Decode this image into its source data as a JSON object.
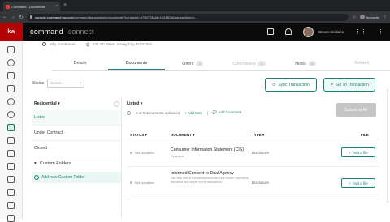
{
  "browser": {
    "tab_title": "Command | Documents",
    "url_host": "console.command.kw.com",
    "url_path": "/command/transactions/documents?contactId=8795778&id=1624806&transactionId=...",
    "incognito_label": "Incognito"
  },
  "app": {
    "logo": "kw",
    "brand": "command",
    "brand_secondary": "connect",
    "user_name": "Steven Siciliano"
  },
  "contact": {
    "name": "Billy Sunderman",
    "address": "234 4th Street Jersey City, NJ 07302"
  },
  "tabs": [
    {
      "label": "Details"
    },
    {
      "label": "Documents"
    },
    {
      "label": "Offers",
      "count": "0"
    },
    {
      "label": "Commission",
      "count": "0"
    },
    {
      "label": "Notes",
      "count": "0"
    },
    {
      "label": "Related"
    }
  ],
  "status": {
    "label": "Status",
    "placeholder": "Select..."
  },
  "buttons": {
    "sync": "Sync Transaction",
    "goto": "Go To Transaction",
    "submit": "Submit to AF"
  },
  "folders": {
    "header": "Residential",
    "items": [
      "Listed",
      "Under Contract",
      "Closed"
    ],
    "custom_header": "Custom Folders",
    "add_label": "Add new Custom Folder"
  },
  "documents": {
    "header": "Listed",
    "uploaded_text": "0 of 8 documents uploaded",
    "add_item": "Add item",
    "add_comment": "Add Comment",
    "columns": {
      "status": "STATUS",
      "document": "DOCUMENT",
      "type": "TYPE",
      "file": "FILE"
    },
    "rows": [
      {
        "status": "Not uploaded",
        "name": "Consumer Information Statement (CIS)",
        "sub": "Required",
        "type": "Disclosure",
        "action": "Add a file"
      },
      {
        "status": "Not uploaded",
        "name": "Informed Consent to Dual Agency",
        "sub": "",
        "desc": "Use this form if the salesperson and the broker represent the seller and buyer in the transaction.",
        "type": "Disclosure",
        "action": "Add a file"
      }
    ]
  }
}
